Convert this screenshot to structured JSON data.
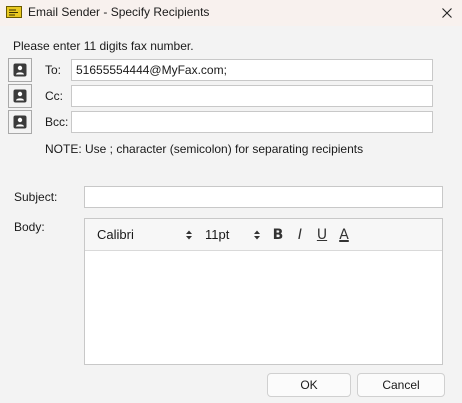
{
  "window": {
    "title": "Email Sender - Specify Recipients",
    "title_icon": "envelope-icon",
    "close_icon": "close-icon"
  },
  "instruction": "Please enter 11 digits fax number.",
  "recipients": {
    "to": {
      "label": "To:",
      "value": "51655554444@MyFax.com;"
    },
    "cc": {
      "label": "Cc:",
      "value": ""
    },
    "bcc": {
      "label": "Bcc:",
      "value": ""
    },
    "contact_icon": "contact-card-icon"
  },
  "note": "NOTE: Use ; character (semicolon) for separating recipients",
  "subject": {
    "label": "Subject:",
    "value": ""
  },
  "body": {
    "label": "Body:",
    "font": "Calibri",
    "size": "11pt",
    "bold_label": "B",
    "italic_label": "I",
    "underline_label": "U",
    "font_color_label": "A",
    "value": ""
  },
  "buttons": {
    "ok": "OK",
    "cancel": "Cancel"
  },
  "colors": {
    "title_bar": "#f8f1ee",
    "background": "#f3f3f3",
    "envelope": "#e9c81f"
  }
}
